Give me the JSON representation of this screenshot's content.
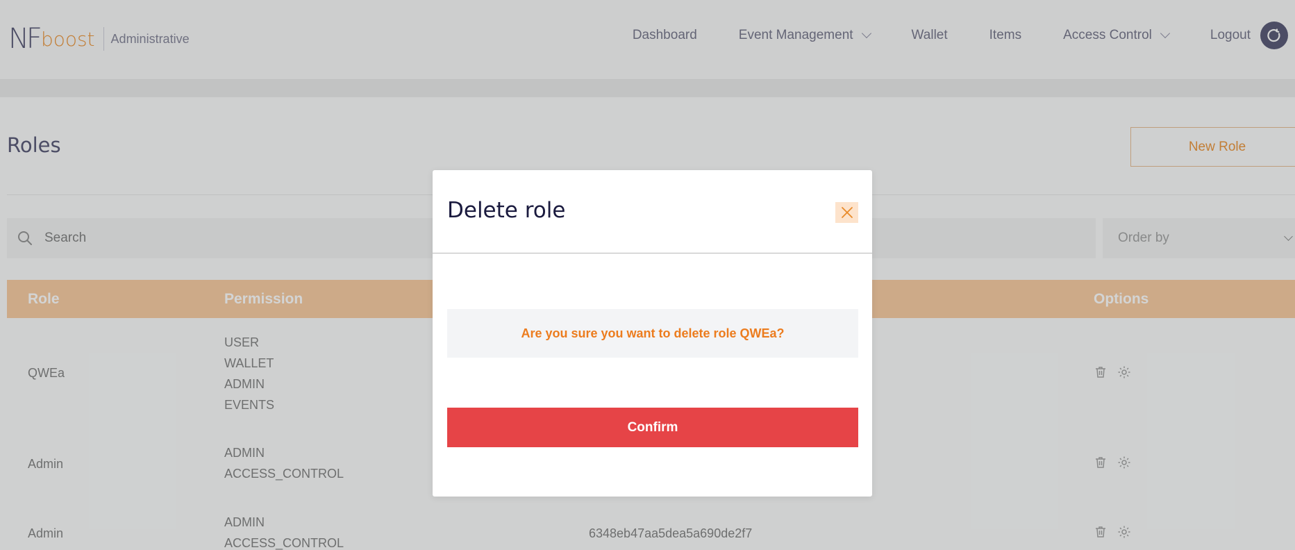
{
  "header": {
    "logo_nf": "NF",
    "logo_boost": "boost",
    "subtitle": "Administrative",
    "nav": {
      "dashboard": "Dashboard",
      "event_management": "Event Management",
      "wallet": "Wallet",
      "items": "Items",
      "access_control": "Access Control",
      "logout": "Logout"
    }
  },
  "page": {
    "title": "Roles",
    "new_role_label": "New Role",
    "search_placeholder": "Search",
    "order_by": "Order by"
  },
  "table": {
    "headers": {
      "role": "Role",
      "permission": "Permission",
      "options": "Options"
    },
    "rows": [
      {
        "role": "QWEa",
        "permissions": [
          "USER",
          "WALLET",
          "ADMIN",
          "EVENTS"
        ],
        "id": ""
      },
      {
        "role": "Admin",
        "permissions": [
          "ADMIN",
          "ACCESS_CONTROL"
        ],
        "id": ""
      },
      {
        "role": "Admin",
        "permissions": [
          "ADMIN",
          "ACCESS_CONTROL"
        ],
        "id": "6348eb47aa5dea5a690de2f7"
      }
    ]
  },
  "modal": {
    "title": "Delete role",
    "message": "Are you sure you want to delete role QWEa?",
    "confirm_label": "Confirm"
  },
  "colors": {
    "accent_orange": "#e98b2a",
    "table_header": "#f7c799",
    "confirm_red": "#e64447",
    "dark_navy": "#4a4a6a"
  }
}
